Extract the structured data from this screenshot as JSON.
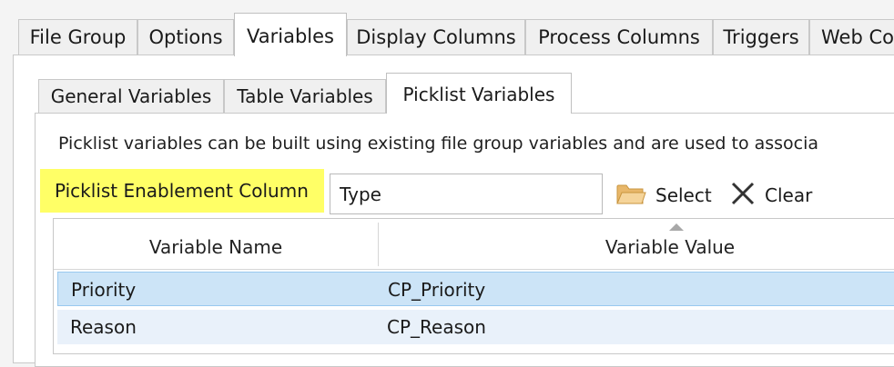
{
  "outer_tabs": [
    {
      "label": "File Group",
      "active": false
    },
    {
      "label": "Options",
      "active": false
    },
    {
      "label": "Variables",
      "active": true
    },
    {
      "label": "Display Columns",
      "active": false
    },
    {
      "label": "Process Columns",
      "active": false
    },
    {
      "label": "Triggers",
      "active": false
    },
    {
      "label": "Web Co",
      "active": false
    }
  ],
  "inner_tabs": [
    {
      "label": "General Variables",
      "active": false
    },
    {
      "label": "Table Variables",
      "active": false
    },
    {
      "label": "Picklist Variables",
      "active": true
    }
  ],
  "picklist": {
    "description": "Picklist variables can be built using existing file group variables and are used to associa",
    "enablement_label": "Picklist Enablement Column",
    "enablement_value": "Type",
    "select_label": "Select",
    "clear_label": "Clear",
    "highlight_color": "#ffff66"
  },
  "grid": {
    "columns": [
      "Variable Name",
      "Variable Value"
    ],
    "rows": [
      {
        "name": "Priority",
        "value": "CP_Priority",
        "selected": true
      },
      {
        "name": "Reason",
        "value": "CP_Reason",
        "selected": false
      }
    ]
  }
}
